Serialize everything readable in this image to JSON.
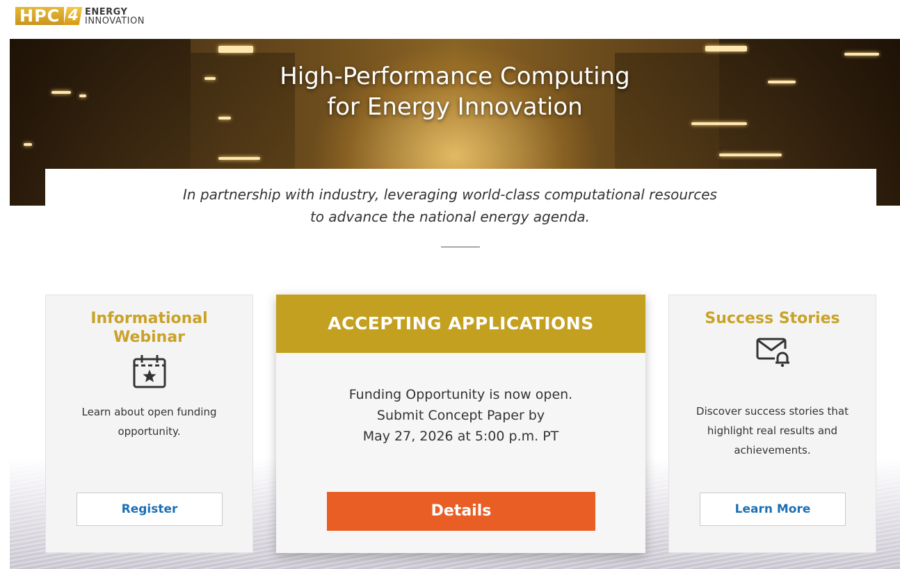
{
  "logo": {
    "mark_text": "HPC",
    "mark_number": "4",
    "line1": "ENERGY",
    "line2": "INNOVATION"
  },
  "hero": {
    "title_line1": "High-Performance Computing",
    "title_line2": "for Energy Innovation"
  },
  "tagline": {
    "line1": "In partnership with industry, leveraging world-class computational resources",
    "line2": "to advance the national energy agenda."
  },
  "cards": {
    "webinar": {
      "title": "Informational Webinar",
      "icon": "calendar-star-icon",
      "text": "Learn about open funding opportunity.",
      "button": "Register"
    },
    "applications": {
      "header": "ACCEPTING APPLICATIONS",
      "line1": "Funding Opportunity is now open.",
      "line2": "Submit Concept Paper by",
      "line3": "May 27, 2026 at 5:00 p.m. PT",
      "button": "Details"
    },
    "success": {
      "title": "Success Stories",
      "icon": "mail-bell-icon",
      "text": "Discover success stories that highlight real results and achievements.",
      "button": "Learn More"
    }
  },
  "colors": {
    "gold": "#c4a020",
    "orange": "#e85e25",
    "link_blue": "#1b6fb5"
  }
}
